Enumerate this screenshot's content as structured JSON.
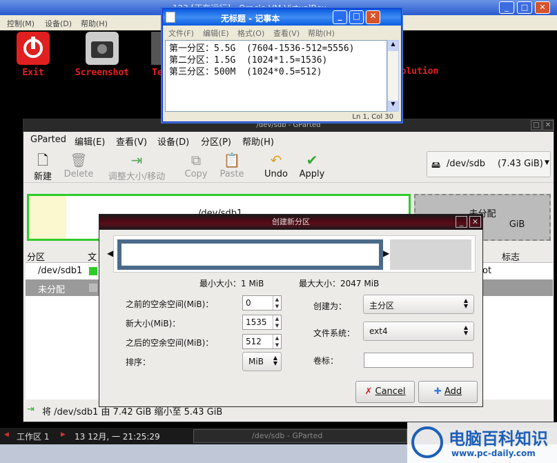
{
  "vbox": {
    "title": "123 [正在运行] - Oracle VM VirtualBox",
    "menu": [
      "控制(M)",
      "设备(D)",
      "帮助(H)"
    ]
  },
  "desktop_icons": [
    {
      "label": "Exit",
      "icon": "power-icon"
    },
    {
      "label": "Screenshot",
      "icon": "camera-icon"
    },
    {
      "label": "Te",
      "icon": "terminal-icon"
    },
    {
      "label": "olution",
      "icon": "resolution-icon"
    }
  ],
  "notepad": {
    "title": "无标题 - 记事本",
    "menu": [
      "文件(F)",
      "编辑(E)",
      "格式(O)",
      "查看(V)",
      "帮助(H)"
    ],
    "lines": [
      "第一分区：5.5G  (7604-1536-512=5556)",
      "第二分区：1.5G  (1024*1.5=1536)",
      "第三分区：500M  (1024*0.5=512)"
    ],
    "status": "Ln 1, Col 30"
  },
  "gparted": {
    "title": "/dev/sdb - GParted",
    "menu": [
      "GParted",
      "编辑(E)",
      "查看(V)",
      "设备(D)",
      "分区(P)",
      "帮助(H)"
    ],
    "toolbar": {
      "new": "新建",
      "delete": "Delete",
      "resize": "调整大小/移动",
      "copy": "Copy",
      "paste": "Paste",
      "undo": "Undo",
      "apply": "Apply"
    },
    "device": "/dev/sdb",
    "device_size": "(7.43 GiB)",
    "map": {
      "part1": "/dev/sdb1",
      "unalloc": "未分配",
      "unalloc_size": "GiB"
    },
    "columns": [
      "分区",
      "文",
      "标志"
    ],
    "rows": [
      {
        "name": "/dev/sdb1",
        "flag": "ot"
      },
      {
        "name": "未分配",
        "flag": ""
      }
    ],
    "status": "将 /dev/sdb1 由 7.42 GiB 缩小至 5.43 GiB"
  },
  "dialog": {
    "title": "创建新分区",
    "min_size": "最小大小：1 MiB",
    "max_size": "最大大小：2047 MiB",
    "free_before_label": "之前的空余空间(MiB)：",
    "free_before": "0",
    "new_size_label": "新大小(MiB)：",
    "new_size": "1535",
    "free_after_label": "之后的空余空间(MiB)：",
    "free_after": "512",
    "align_label": "排序：",
    "align": "MiB",
    "create_as_label": "创建为：",
    "create_as": "主分区",
    "fs_label": "文件系统：",
    "fs": "ext4",
    "vol_label": "卷标：",
    "vol": "",
    "cancel": "Cancel",
    "add": "Add"
  },
  "taskbar": {
    "workspace": "工作区 1",
    "clock": "13 12月, 一 21:25:29",
    "task": "/dev/sdb - GParted"
  },
  "watermark": {
    "title": "电脑百科知识",
    "url": "www.pc-daily.com"
  }
}
